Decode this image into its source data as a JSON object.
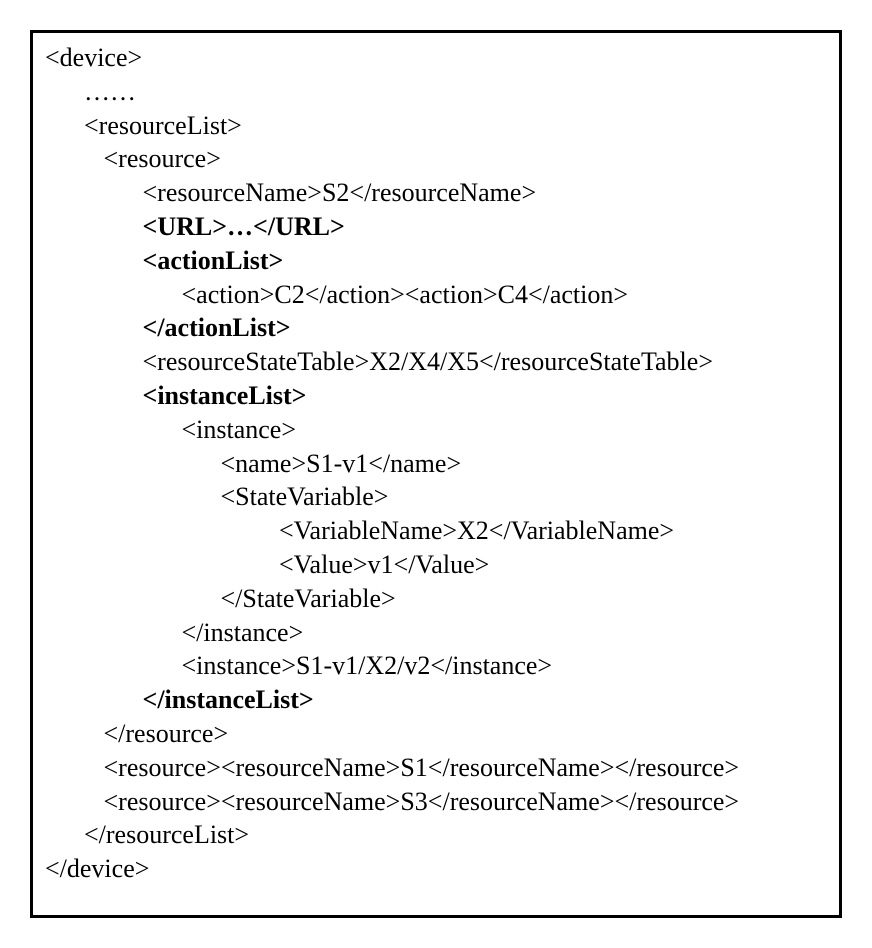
{
  "lines": [
    {
      "indent": 0,
      "bold": false,
      "text": "<device>"
    },
    {
      "indent": 2,
      "bold": false,
      "text": "……"
    },
    {
      "indent": 2,
      "bold": false,
      "text": "<resourceList>"
    },
    {
      "indent": 3,
      "bold": false,
      "text": "<resource>"
    },
    {
      "indent": 5,
      "bold": false,
      "text": "<resourceName>S2</resourceName>"
    },
    {
      "indent": 5,
      "bold": true,
      "text": "<URL>…</URL>"
    },
    {
      "indent": 5,
      "bold": true,
      "text": "<actionList>"
    },
    {
      "indent": 7,
      "bold": false,
      "text": "<action>C2</action><action>C4</action>"
    },
    {
      "indent": 5,
      "bold": true,
      "text": "</actionList>"
    },
    {
      "indent": 5,
      "bold": false,
      "text": "<resourceStateTable>X2/X4/X5</resourceStateTable>"
    },
    {
      "indent": 5,
      "bold": true,
      "text": "<instanceList>"
    },
    {
      "indent": 7,
      "bold": false,
      "text": "<instance>"
    },
    {
      "indent": 9,
      "bold": false,
      "text": "<name>S1-v1</name>"
    },
    {
      "indent": 9,
      "bold": false,
      "text": "<StateVariable>"
    },
    {
      "indent": 12,
      "bold": false,
      "text": "<VariableName>X2</VariableName>"
    },
    {
      "indent": 12,
      "bold": false,
      "text": "<Value>v1</Value>"
    },
    {
      "indent": 9,
      "bold": false,
      "text": "</StateVariable>"
    },
    {
      "indent": 7,
      "bold": false,
      "text": "</instance>"
    },
    {
      "indent": 7,
      "bold": false,
      "text": "<instance>S1-v1/X2/v2</instance>"
    },
    {
      "indent": 5,
      "bold": true,
      "text": "</instanceList>"
    },
    {
      "indent": 3,
      "bold": false,
      "text": "</resource>"
    },
    {
      "indent": 3,
      "bold": false,
      "text": "<resource><resourceName>S1</resourceName></resource>"
    },
    {
      "indent": 3,
      "bold": false,
      "text": "<resource><resourceName>S3</resourceName></resource>"
    },
    {
      "indent": 2,
      "bold": false,
      "text": "</resourceList>"
    },
    {
      "indent": 0,
      "bold": false,
      "text": "</device>"
    }
  ]
}
